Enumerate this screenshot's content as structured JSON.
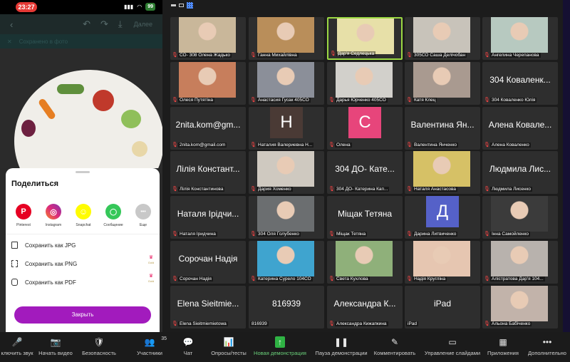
{
  "status_bar": {
    "time": "23:27",
    "battery": "99"
  },
  "app_bar": {
    "done": "Далее"
  },
  "saved_bar": {
    "text": "Сохранено в фото"
  },
  "share_sheet": {
    "title": "Поделиться",
    "apps": [
      {
        "label": "Pinterest",
        "icon": "pinterest-icon",
        "color": "#e60023",
        "glyph": "P"
      },
      {
        "label": "Instagram",
        "icon": "instagram-icon",
        "color": "#c13584",
        "glyph": "◎"
      },
      {
        "label": "Snapchat",
        "icon": "snapchat-icon",
        "color": "#fffc00",
        "glyph": "☺"
      },
      {
        "label": "Сообщение",
        "icon": "messages-icon",
        "color": "#35c759",
        "glyph": "💬"
      },
      {
        "label": "Еще",
        "icon": "more-icon",
        "color": "#c8c8c8",
        "glyph": "•••"
      }
    ],
    "save_options": [
      {
        "label": "Сохранить как JPG",
        "icon": "image-icon",
        "gold": false
      },
      {
        "label": "Сохранить как PNG",
        "icon": "png-icon",
        "gold": true
      },
      {
        "label": "Сохранить как PDF",
        "icon": "pdf-icon",
        "gold": true
      }
    ],
    "gold_label": "Gold",
    "close": "Закрыть"
  },
  "gallery": {
    "tiles": [
      {
        "caption": "СО- 308 Олена Жадько",
        "type": "photo",
        "bg": "#c9b79a"
      },
      {
        "caption": "Ганна Михайлівна",
        "type": "photo",
        "bg": "#b98e5a"
      },
      {
        "caption": "Дар'я Седлецька",
        "type": "photo",
        "bg": "#e7e0a8",
        "active": true
      },
      {
        "caption": "305СО Саша Делічобан",
        "type": "photo",
        "bg": "#c8c3ba"
      },
      {
        "caption": "Ангелина Черепанова",
        "type": "photo",
        "bg": "#b7c9c0"
      },
      {
        "caption": "Олеся Путятіна",
        "type": "photo",
        "bg": "#c77e5c"
      },
      {
        "caption": "Анастасия Гусак 405СО",
        "type": "photo",
        "bg": "#8b8f99"
      },
      {
        "caption": "Дарья Юрченко 405СО",
        "type": "photo",
        "bg": "#d2d0cb"
      },
      {
        "caption": "Катя Клец",
        "type": "photo",
        "bg": "#a99a90"
      },
      {
        "caption": "304 Коваленко Юлія",
        "type": "name",
        "name": "304 Коваленк..."
      },
      {
        "caption": "2nita.kom@gmail.com",
        "type": "name",
        "name": "2nita.kom@gm..."
      },
      {
        "caption": "Наталия Валериевна Н...",
        "type": "letter",
        "letter": "Н",
        "bg": "#4a3a35"
      },
      {
        "caption": "Олена",
        "type": "letter",
        "letter": "С",
        "bg": "#e7457b"
      },
      {
        "caption": "Валентина Янченко",
        "type": "name",
        "name": "Валентина Ян..."
      },
      {
        "caption": "Алена Коваленко",
        "type": "name",
        "name": "Алена Ковале..."
      },
      {
        "caption": "Лілія Константинова",
        "type": "name",
        "name": "Лілія Констант..."
      },
      {
        "caption": "Дария Хоменко",
        "type": "photo",
        "bg": "#cfc9c0"
      },
      {
        "caption": "304 ДО- Катерина Кап...",
        "type": "name",
        "name": "304 ДО- Кате..."
      },
      {
        "caption": "Наталя Анастасова",
        "type": "photo",
        "bg": "#d6c166"
      },
      {
        "caption": "Людмила Лисенко",
        "type": "name",
        "name": "Людмила Лис..."
      },
      {
        "caption": "Наталя Іридчина",
        "type": "name",
        "name": "Наталя Ірідчи..."
      },
      {
        "caption": "304 Оля Голубенко",
        "type": "photo",
        "bg": "#6b6e70"
      },
      {
        "caption": "Міщак Тетяна",
        "type": "name",
        "name": "Міщак Тетяна"
      },
      {
        "caption": "Дарина Литвиченко",
        "type": "letter",
        "letter": "Д",
        "bg": "#5561c8"
      },
      {
        "caption": "Інна Самойленко",
        "type": "photo",
        "bg": "#3b3b3b"
      },
      {
        "caption": "Сорочан Надія",
        "type": "name",
        "name": "Сорочан Надія"
      },
      {
        "caption": "Катерина Сурело 104СО",
        "type": "photo",
        "bg": "#3fa4cf"
      },
      {
        "caption": "Света Кухлова",
        "type": "photo",
        "bg": "#8fb07a"
      },
      {
        "caption": "Надія Кругліна",
        "type": "photo",
        "bg": "#e6c6b1"
      },
      {
        "caption": "Алістратова Дар'я 104...",
        "type": "photo",
        "bg": "#b8b2ad"
      },
      {
        "caption": "Elena Sieitmiemietowa",
        "type": "name",
        "name": "Elena Sieitmie..."
      },
      {
        "caption": "816939",
        "type": "name",
        "name": "816939",
        "nomic": true
      },
      {
        "caption": "Александра Кижапкина",
        "type": "name",
        "name": "Александра К..."
      },
      {
        "caption": "iPad",
        "type": "name",
        "name": "iPad",
        "nomic": true
      },
      {
        "caption": "Альона Бабіченко",
        "type": "photo",
        "bg": "#c2b3aa"
      }
    ]
  },
  "toolbar": {
    "items": [
      {
        "label": "ключить звук",
        "icon": "mic-muted-icon",
        "glyph": "🎤",
        "muted": true
      },
      {
        "label": "Начать видео",
        "icon": "video-off-icon",
        "glyph": "📷",
        "muted": true
      },
      {
        "label": "Безопасность",
        "icon": "shield-icon",
        "glyph": "🛡"
      },
      {
        "label": "Участники",
        "icon": "participants-icon",
        "glyph": "👥",
        "badge": "35"
      },
      {
        "label": "Чат",
        "icon": "chat-icon",
        "glyph": "💬"
      },
      {
        "label": "Опросы/тесты",
        "icon": "polls-icon",
        "glyph": "📊"
      },
      {
        "label": "Новая демонстрация",
        "icon": "share-screen-icon",
        "glyph": "↑",
        "green": true
      },
      {
        "label": "Пауза демонстрации",
        "icon": "pause-icon",
        "glyph": "❚❚"
      },
      {
        "label": "Комментировать",
        "icon": "annotate-icon",
        "glyph": "✎"
      },
      {
        "label": "Управление слайдами",
        "icon": "slides-icon",
        "glyph": "▭"
      },
      {
        "label": "Приложения",
        "icon": "apps-icon",
        "glyph": "▦"
      },
      {
        "label": "Дополнительно",
        "icon": "more-icon",
        "glyph": "•••"
      }
    ]
  }
}
